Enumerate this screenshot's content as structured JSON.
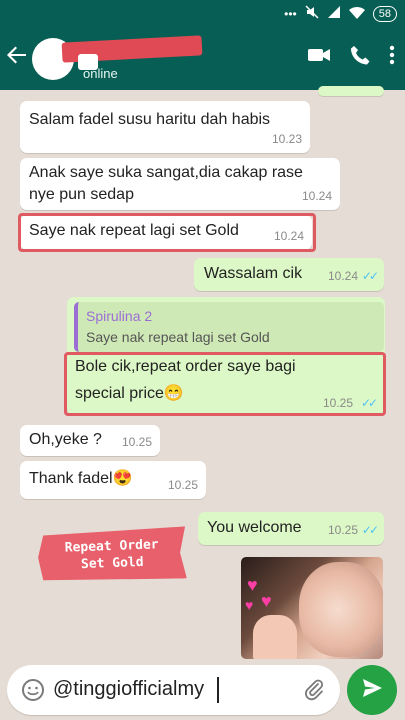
{
  "status_bar": {
    "battery": "58",
    "icons": [
      "dots-icon",
      "mute-icon",
      "signal-icon",
      "wifi-icon",
      "battery-icon"
    ]
  },
  "header": {
    "status": "online",
    "icons": [
      "back-arrow-icon",
      "video-call-icon",
      "phone-icon",
      "more-options-icon"
    ]
  },
  "messages": [
    {
      "text": "Salam fadel susu haritu dah habis",
      "time": "10.23",
      "direction": "in"
    },
    {
      "text_lines": [
        "Anak saye suka sangat,dia cakap rase",
        "nye pun sedap"
      ],
      "time": "10.24",
      "direction": "in"
    },
    {
      "text": "Saye nak repeat lagi set Gold",
      "time": "10.24",
      "direction": "in",
      "highlighted": true
    },
    {
      "text": "Wassalam cik",
      "time": "10.24",
      "direction": "out",
      "status": "read"
    },
    {
      "quote_author": "Spirulina 2",
      "quote_text": "Saye nak repeat lagi set Gold",
      "text_lines": [
        "Bole cik,repeat order saye bagi",
        "special price😁"
      ],
      "time": "10.25",
      "direction": "out",
      "status": "read",
      "highlighted": true
    },
    {
      "text": "Oh,yeke ?",
      "time": "10.25",
      "direction": "in"
    },
    {
      "text": "Thank fadel😍",
      "time": "10.25",
      "direction": "in"
    },
    {
      "text": "You welcome",
      "time": "10.25",
      "direction": "out",
      "status": "read"
    }
  ],
  "read_ticks": "✓✓",
  "sticker": {
    "lines": [
      "Repeat Order",
      "Set Gold"
    ]
  },
  "composer": {
    "value": "@tinggiofficialmy",
    "icons": [
      "emoji-icon",
      "attach-icon",
      "send-icon"
    ]
  },
  "colors": {
    "header": "#075e54",
    "incoming": "#ffffff",
    "outgoing": "#dcf8c6",
    "highlight": "#e05a62",
    "send": "#25a244",
    "chat_bg": "#e5ddd5"
  }
}
